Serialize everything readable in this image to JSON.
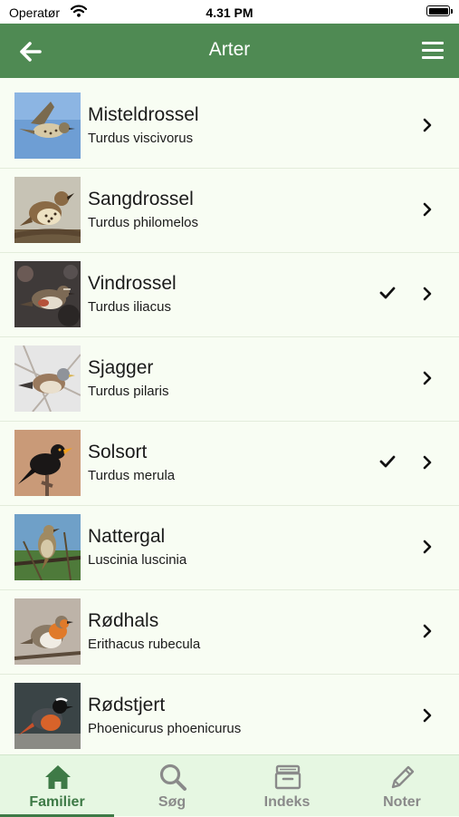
{
  "status": {
    "carrier": "Operatør",
    "time": "4.31 PM"
  },
  "header": {
    "title": "Arter",
    "background": "#4f8a53"
  },
  "species": [
    {
      "name": "Misteldrossel",
      "latin": "Turdus viscivorus",
      "checked": false
    },
    {
      "name": "Sangdrossel",
      "latin": "Turdus philomelos",
      "checked": false
    },
    {
      "name": "Vindrossel",
      "latin": "Turdus iliacus",
      "checked": true
    },
    {
      "name": "Sjagger",
      "latin": "Turdus pilaris",
      "checked": false
    },
    {
      "name": "Solsort",
      "latin": "Turdus merula",
      "checked": true
    },
    {
      "name": "Nattergal",
      "latin": "Luscinia luscinia",
      "checked": false
    },
    {
      "name": "Rødhals",
      "latin": "Erithacus rubecula",
      "checked": false
    },
    {
      "name": "Rødstjert",
      "latin": "Phoenicurus phoenicurus",
      "checked": false
    }
  ],
  "tabs": [
    {
      "label": "Familier",
      "icon": "home-icon",
      "active": true
    },
    {
      "label": "Søg",
      "icon": "search-icon",
      "active": false
    },
    {
      "label": "Indeks",
      "icon": "archive-icon",
      "active": false
    },
    {
      "label": "Noter",
      "icon": "pencil-icon",
      "active": false
    }
  ]
}
